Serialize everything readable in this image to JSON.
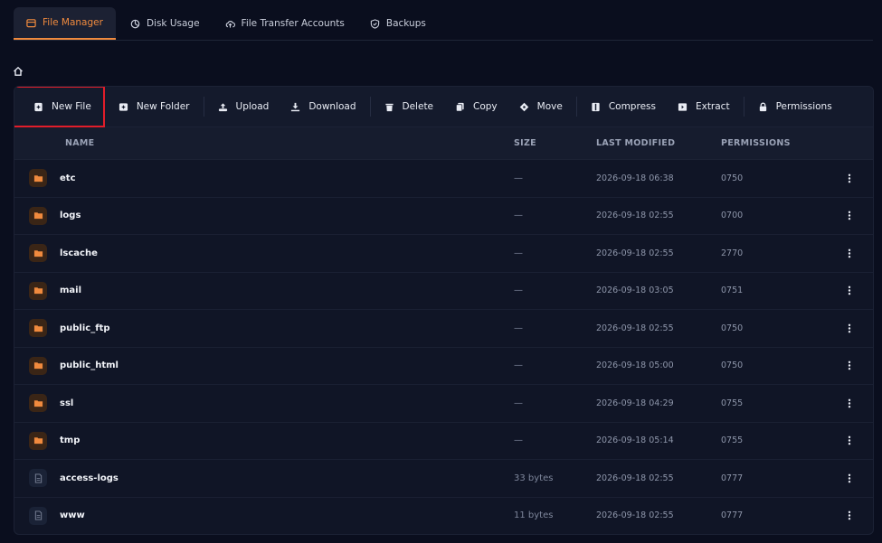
{
  "tabs": [
    {
      "label": "File Manager",
      "icon": "folder-icon",
      "active": true
    },
    {
      "label": "Disk Usage",
      "icon": "pie-chart-icon",
      "active": false
    },
    {
      "label": "File Transfer Accounts",
      "icon": "cloud-upload-icon",
      "active": false
    },
    {
      "label": "Backups",
      "icon": "shield-icon",
      "active": false
    }
  ],
  "toolbar": {
    "new_file": "New File",
    "new_folder": "New Folder",
    "upload": "Upload",
    "download": "Download",
    "delete": "Delete",
    "copy": "Copy",
    "move": "Move",
    "compress": "Compress",
    "extract": "Extract",
    "permissions": "Permissions"
  },
  "table": {
    "columns": {
      "name": "NAME",
      "size": "SIZE",
      "modified": "LAST MODIFIED",
      "permissions": "PERMISSIONS"
    },
    "rows": [
      {
        "type": "folder",
        "name": "etc",
        "size": "—",
        "modified": "2026-09-18 06:38",
        "permissions": "0750"
      },
      {
        "type": "folder",
        "name": "logs",
        "size": "—",
        "modified": "2026-09-18 02:55",
        "permissions": "0700"
      },
      {
        "type": "folder",
        "name": "lscache",
        "size": "—",
        "modified": "2026-09-18 02:55",
        "permissions": "2770"
      },
      {
        "type": "folder",
        "name": "mail",
        "size": "—",
        "modified": "2026-09-18 03:05",
        "permissions": "0751"
      },
      {
        "type": "folder",
        "name": "public_ftp",
        "size": "—",
        "modified": "2026-09-18 02:55",
        "permissions": "0750"
      },
      {
        "type": "folder",
        "name": "public_html",
        "size": "—",
        "modified": "2026-09-18 05:00",
        "permissions": "0750"
      },
      {
        "type": "folder",
        "name": "ssl",
        "size": "—",
        "modified": "2026-09-18 04:29",
        "permissions": "0755"
      },
      {
        "type": "folder",
        "name": "tmp",
        "size": "—",
        "modified": "2026-09-18 05:14",
        "permissions": "0755"
      },
      {
        "type": "file",
        "name": "access-logs",
        "size": "33 bytes",
        "modified": "2026-09-18 02:55",
        "permissions": "0777"
      },
      {
        "type": "file",
        "name": "www",
        "size": "11 bytes",
        "modified": "2026-09-18 02:55",
        "permissions": "0777"
      }
    ]
  },
  "colors": {
    "accent": "#f08a3e",
    "background": "#0a0e1e",
    "panel": "#101526",
    "highlight": "#e11d2a"
  }
}
